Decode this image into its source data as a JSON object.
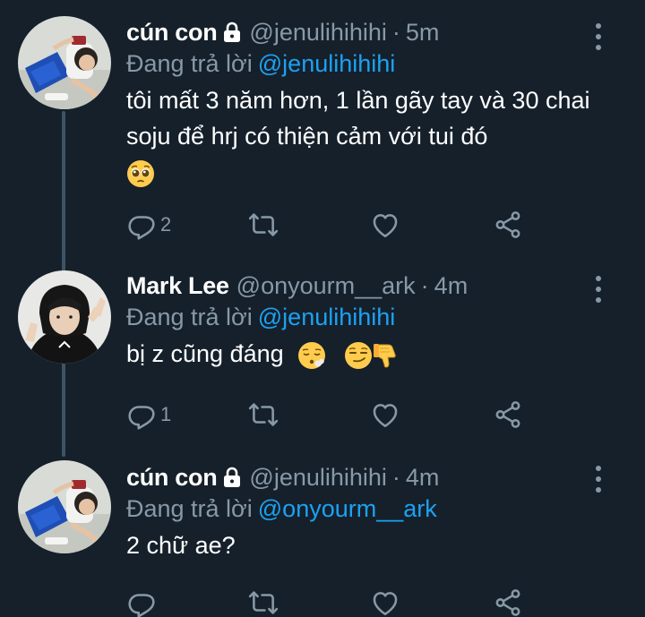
{
  "tweets": [
    {
      "display_name": "cún con",
      "handle": "@jenulihihihi",
      "dot": "·",
      "time": "5m",
      "replying_prefix": "Đang trả lời",
      "replying_to": "@jenulihihihi",
      "text": "tôi mất 3 năm hơn, 1 lần gãy tay và 30 chai soju để hrj có thiện cảm với tui đó",
      "emojis": [
        "pleading-face"
      ],
      "reply_count": "2",
      "protected": true
    },
    {
      "display_name": "Mark Lee",
      "handle": "@onyourm__ark",
      "dot": "·",
      "time": "4m",
      "replying_prefix": "Đang trả lời",
      "replying_to": "@jenulihihihi",
      "text": "bị z cũng đáng",
      "emojis": [
        "face-exhaling",
        "smirking-face",
        "thumbs-down"
      ],
      "reply_count": "1",
      "protected": false
    },
    {
      "display_name": "cún con",
      "handle": "@jenulihihihi",
      "dot": "·",
      "time": "4m",
      "replying_prefix": "Đang trả lời",
      "replying_to": "@onyourm__ark",
      "text": "2 chữ ae?",
      "emojis": [],
      "reply_count": "",
      "protected": true
    }
  ],
  "colors": {
    "background": "#15202b",
    "text_primary": "#ffffff",
    "text_secondary": "#8899a6",
    "accent": "#1da1f2",
    "thread_line": "#3d5466"
  },
  "icons": [
    "reply-icon",
    "retweet-icon",
    "like-icon",
    "share-icon",
    "lock-icon",
    "more-icon"
  ]
}
